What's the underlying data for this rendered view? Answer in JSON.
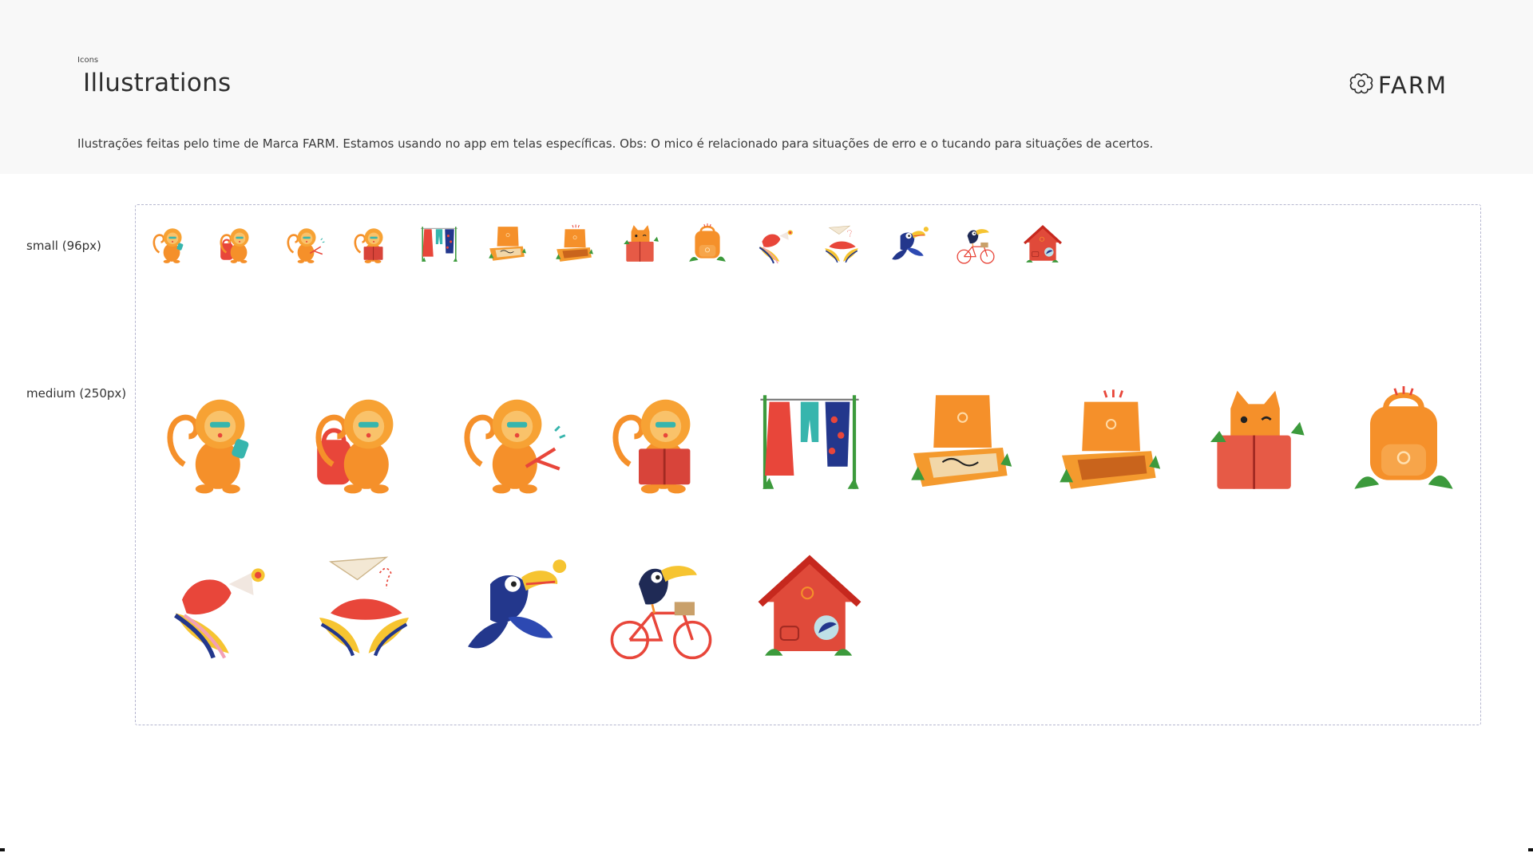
{
  "header": {
    "eyebrow": "Icons",
    "title": "Illustrations",
    "description": "Ilustrações feitas pelo time de Marca FARM. Estamos usando no app em telas específicas. Obs: O mico é relacionado para situações de erro e o tucando para situações de acertos.",
    "logo_text": "FARM"
  },
  "sizes": {
    "small_label": "small (96px)",
    "medium_label": "medium (250px)"
  },
  "illustrations": [
    "monkey-phone",
    "monkey-backpack",
    "monkey-hanger",
    "monkey-book",
    "clothesline",
    "box-open-clothes",
    "box-open-empty",
    "cat-book",
    "backpack",
    "macaw-megaphone",
    "macaw-paper-plane",
    "toucan-flying",
    "toucan-bicycle",
    "house-toucan"
  ],
  "colors": {
    "header_bg": "#f8f8f8",
    "frame_border": "#b6b7d0",
    "orange": "#f5902a",
    "red": "#e8463a",
    "green": "#3c9a3c",
    "blue": "#23378c"
  }
}
